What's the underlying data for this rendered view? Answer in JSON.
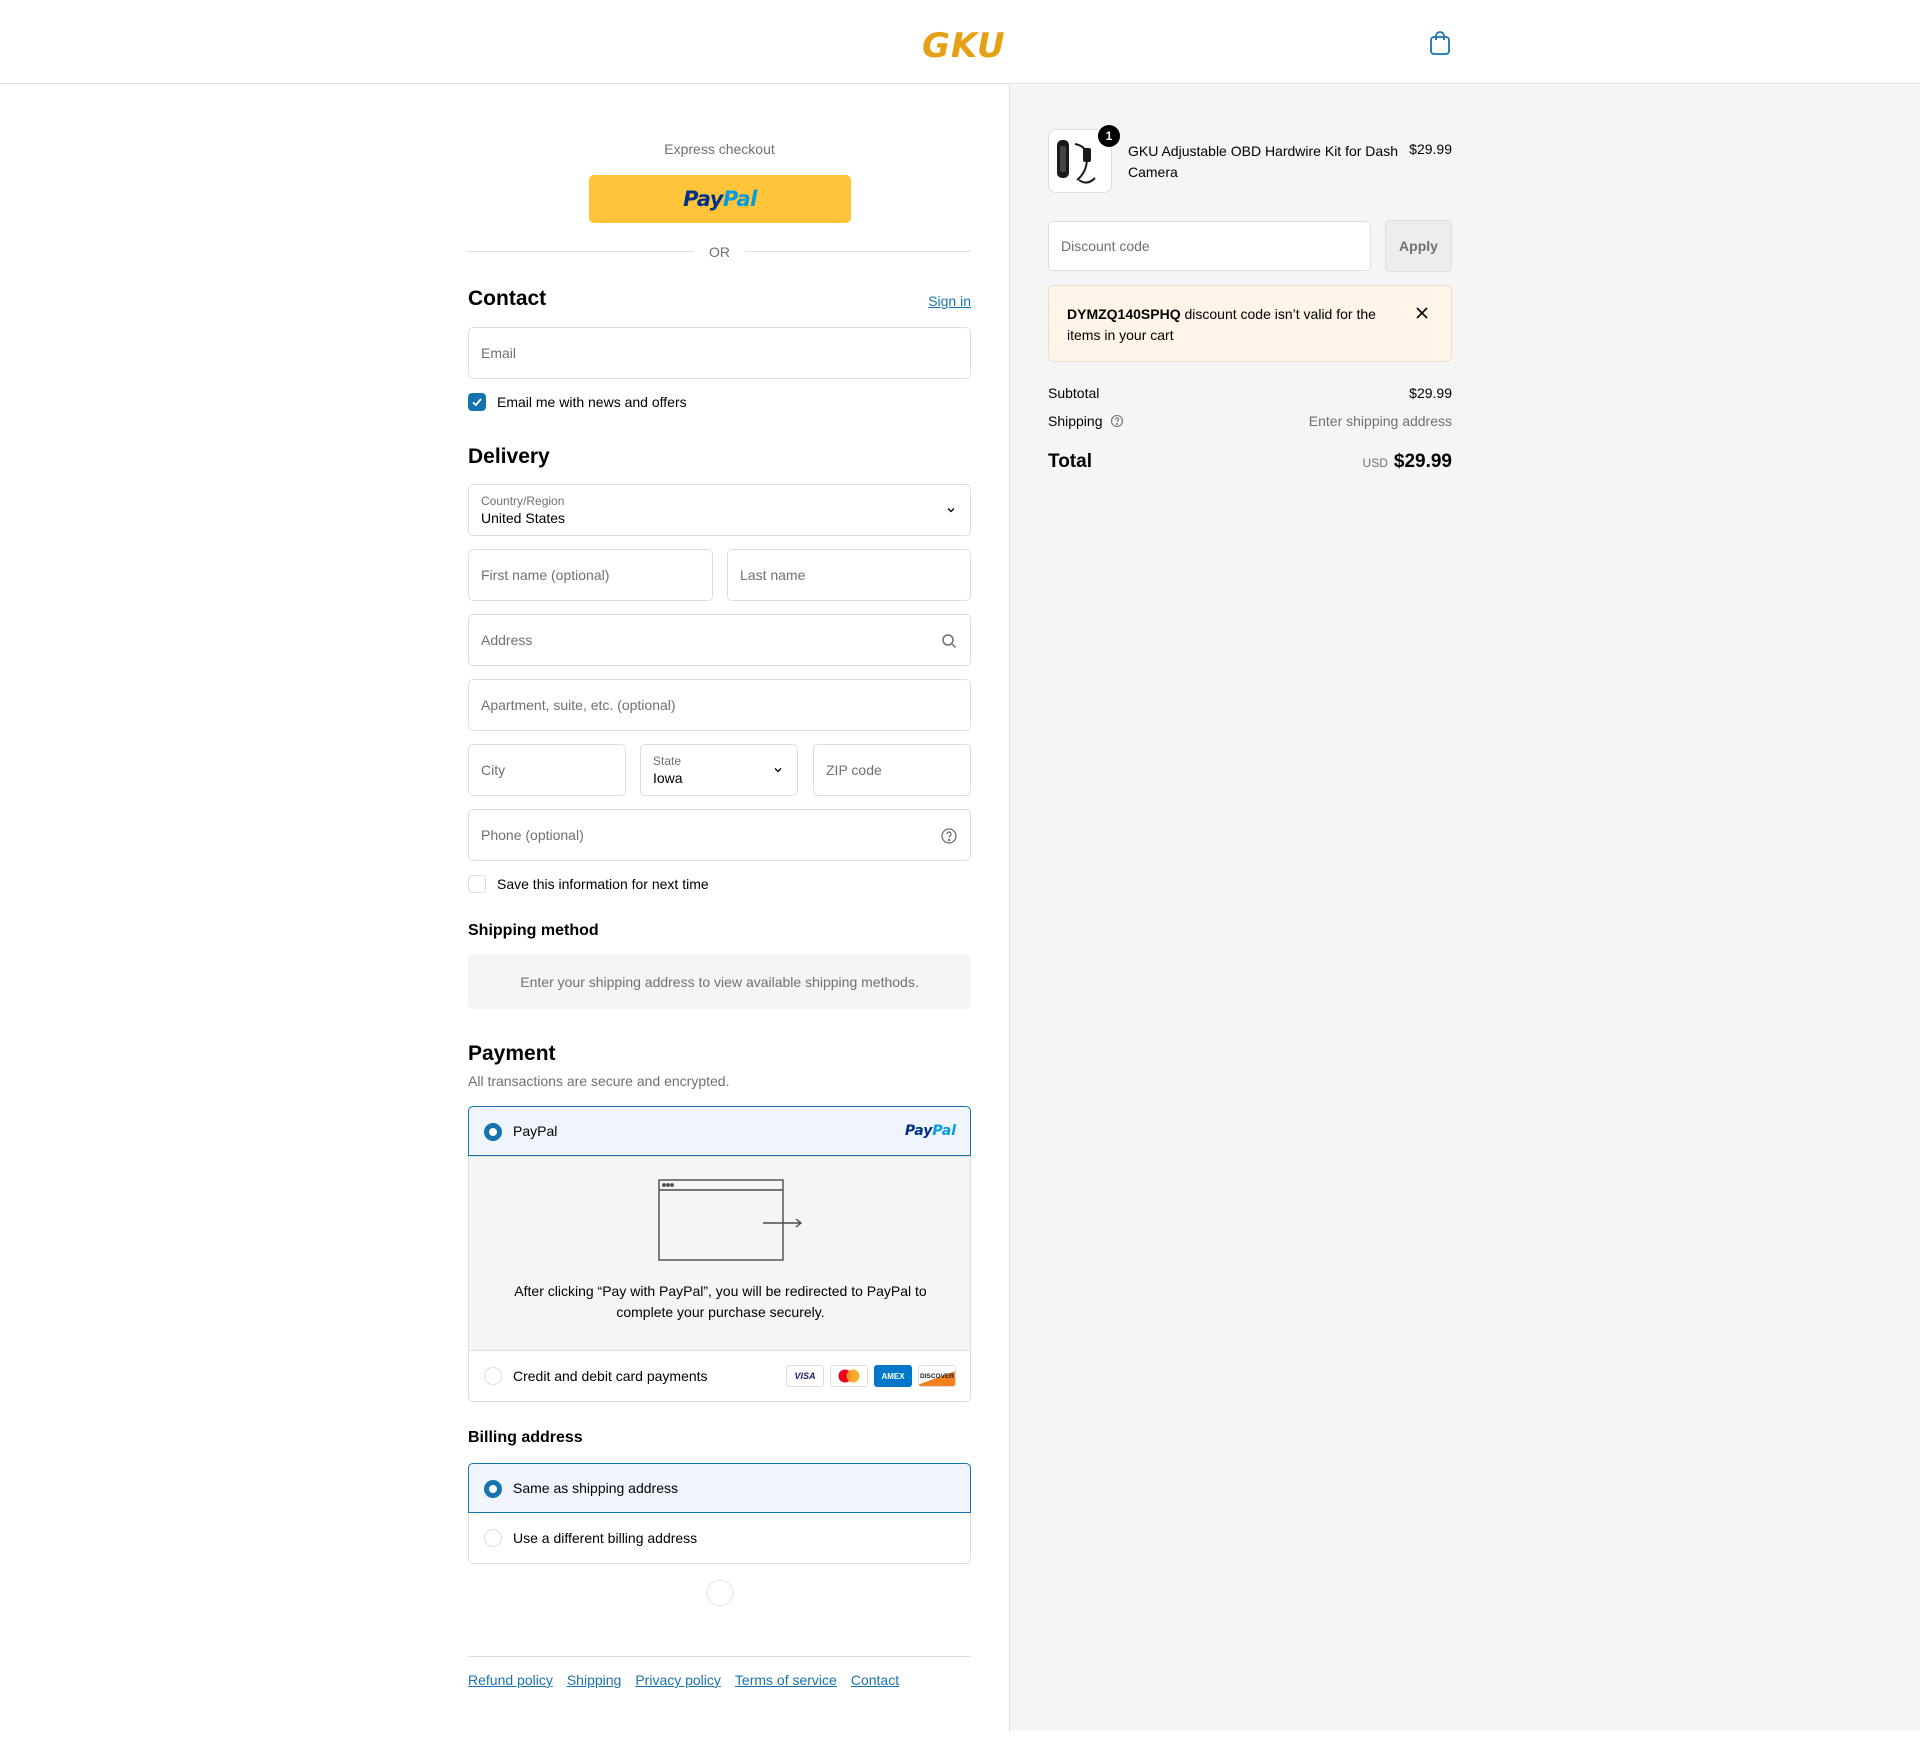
{
  "header": {
    "logo": "GKU",
    "cart_icon": "shopping-bag-icon"
  },
  "express": {
    "title": "Express checkout",
    "paypal_pay": "Pay",
    "paypal_pal": "Pal",
    "or": "OR"
  },
  "contact": {
    "heading": "Contact",
    "sign_in": "Sign in",
    "email_placeholder": "Email",
    "news_label": "Email me with news and offers",
    "news_checked": true
  },
  "delivery": {
    "heading": "Delivery",
    "country_label": "Country/Region",
    "country_value": "United States",
    "first_name_placeholder": "First name (optional)",
    "last_name_placeholder": "Last name",
    "address_placeholder": "Address",
    "apartment_placeholder": "Apartment, suite, etc. (optional)",
    "city_placeholder": "City",
    "state_label": "State",
    "state_value": "Iowa",
    "zip_placeholder": "ZIP code",
    "phone_placeholder": "Phone (optional)",
    "save_label": "Save this information for next time"
  },
  "shipping_method": {
    "heading": "Shipping method",
    "message": "Enter your shipping address to view available shipping methods."
  },
  "payment": {
    "heading": "Payment",
    "subtitle": "All transactions are secure and encrypted.",
    "paypal_label": "PayPal",
    "paypal_mark_pay": "Pay",
    "paypal_mark_pal": "Pal",
    "redirect_message": "After clicking “Pay with PayPal”, you will be redirected to PayPal to complete your purchase securely.",
    "card_label": "Credit and debit card payments",
    "card_brands": [
      "VISA",
      "mastercard",
      "AMEX",
      "DISCOVER"
    ]
  },
  "billing": {
    "heading": "Billing address",
    "same_label": "Same as shipping address",
    "different_label": "Use a different billing address"
  },
  "footer": {
    "links": [
      "Refund policy",
      "Shipping",
      "Privacy policy",
      "Terms of service",
      "Contact"
    ]
  },
  "summary": {
    "product_name": "GKU Adjustable OBD Hardwire Kit for Dash Camera",
    "product_price": "$29.99",
    "quantity": "1",
    "discount_placeholder": "Discount code",
    "apply_label": "Apply",
    "warning_code": "DYMZQ140SPHQ",
    "warning_text": " discount code isn’t valid for the items in your cart",
    "subtotal_label": "Subtotal",
    "subtotal_value": "$29.99",
    "shipping_label": "Shipping",
    "shipping_value": "Enter shipping address",
    "total_label": "Total",
    "currency": "USD",
    "total_value": "$29.99"
  },
  "colors": {
    "accent": "#1773b0",
    "paypal_yellow": "#ffc439",
    "logo": "#e5a113",
    "warning_bg": "#fff4e8"
  }
}
